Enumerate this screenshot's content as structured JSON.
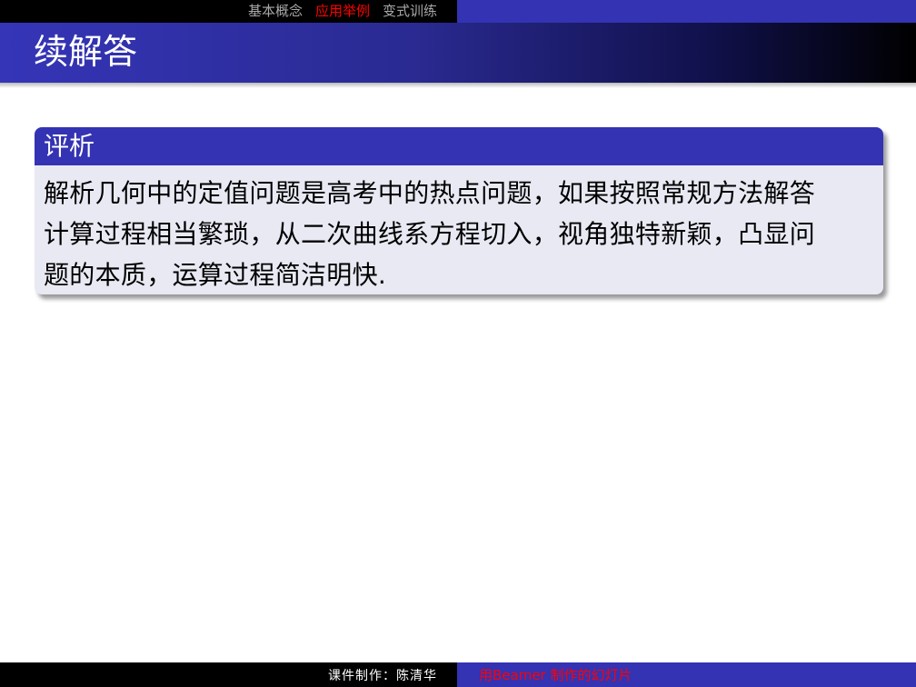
{
  "nav": {
    "items": [
      {
        "label": "基本概念",
        "active": false
      },
      {
        "label": "应用举例",
        "active": true
      },
      {
        "label": "变式训练",
        "active": false
      }
    ]
  },
  "frame": {
    "title": "续解答"
  },
  "block": {
    "title": "评析",
    "lines": [
      "解析几何中的定值问题是高考中的热点问题，如果按照常规方法解答",
      "计算过程相当繁琐，从二次曲线系方程切入，视角独特新颖，凸显问",
      "题的本质，运算过程简洁明快."
    ]
  },
  "footer": {
    "author": "课件制作：陈清华",
    "tagline": "用Beamer 制作的幻灯片"
  },
  "colors": {
    "structure_blue": "#3333b3",
    "alert_red": "#ff0000",
    "block_body": "#e9e9f4"
  }
}
